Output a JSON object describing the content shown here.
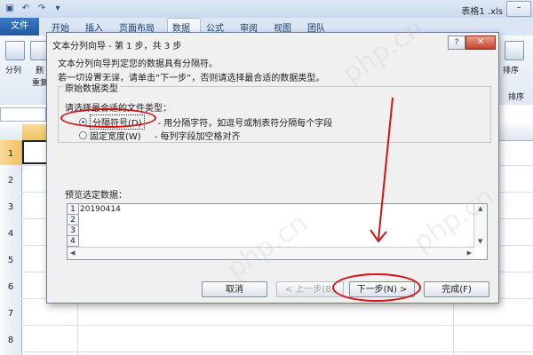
{
  "titlebar": {
    "filename": "表格1 .xls",
    "minimize_glyph": "–"
  },
  "ribbon_tabs": {
    "file": "文件",
    "items": [
      "开始",
      "插入",
      "页面布局",
      "数据",
      "公式",
      "审阅",
      "视图",
      "团队"
    ],
    "active": "数据"
  },
  "ribbon": {
    "left_labels": [
      "分列",
      "删",
      "重复"
    ],
    "right_labels": [
      "排序",
      "排序"
    ]
  },
  "grid": {
    "row_numbers": [
      "1",
      "2",
      "3",
      "4",
      "5",
      "6",
      "7",
      "8"
    ],
    "selected_row": "1"
  },
  "dialog": {
    "title": "文本分列向导 - 第 1 步，共 3 步",
    "help_glyph": "?",
    "close_glyph": "✕",
    "intro_line1": "文本分列向导判定您的数据具有分隔符。",
    "intro_line2": "若一切设置无误，请单击“下一步”，否则请选择最合适的数据类型。",
    "frame_title": "原始数据类型",
    "prompt": "请选择最合适的文件类型：",
    "options": [
      {
        "label": "分隔符号(D)",
        "description": "- 用分隔字符，如逗号或制表符分隔每个字段",
        "selected": true
      },
      {
        "label": "固定宽度(W)",
        "description": "- 每列字段加空格对齐",
        "selected": false
      }
    ],
    "preview_label": "预览选定数据：",
    "preview_rows": [
      {
        "num": "1",
        "value": "20190414"
      },
      {
        "num": "2",
        "value": ""
      },
      {
        "num": "3",
        "value": ""
      },
      {
        "num": "4",
        "value": ""
      }
    ],
    "buttons": {
      "cancel": "取消",
      "back": "< 上一步(B)",
      "next": "下一步(N) >",
      "finish": "完成(F)"
    }
  },
  "annotation_color": "#d41212",
  "watermark": "php.cn"
}
